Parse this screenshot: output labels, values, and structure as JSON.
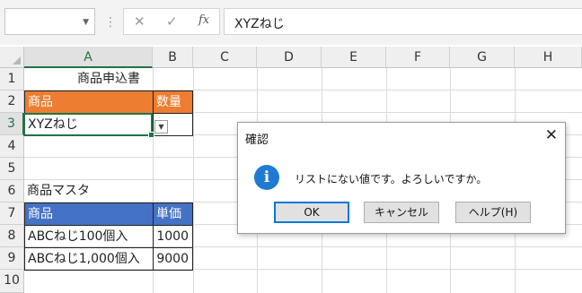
{
  "formula_bar": {
    "cancel_icon": "✕",
    "enter_icon": "✓",
    "fx_label": "fx",
    "content": "XYZねじ"
  },
  "columns": [
    "A",
    "B",
    "C",
    "D",
    "E",
    "F",
    "G",
    "H"
  ],
  "rows": [
    "1",
    "2",
    "3",
    "4",
    "5",
    "6",
    "7",
    "8",
    "9",
    "10"
  ],
  "sheet": {
    "title": "商品申込書",
    "order_header": {
      "product": "商品",
      "quantity": "数量"
    },
    "order_row": {
      "product": "XYZねじ",
      "quantity": ""
    },
    "master_title": "商品マスタ",
    "master_header": {
      "product": "商品",
      "price": "単価"
    },
    "master_rows": [
      {
        "product": "ABCねじ100個入",
        "price": "1000"
      },
      {
        "product": "ABCねじ1,000個入",
        "price": "9000"
      }
    ]
  },
  "dialog": {
    "title": "確認",
    "message": "リストにない値です。よろしいですか。",
    "ok": "OK",
    "cancel": "キャンセル",
    "help": "ヘルプ(H)"
  },
  "colors": {
    "orange": "#ed7d31",
    "blue": "#4472c4",
    "accent": "#217346",
    "info_icon": "#1e7bd3"
  }
}
